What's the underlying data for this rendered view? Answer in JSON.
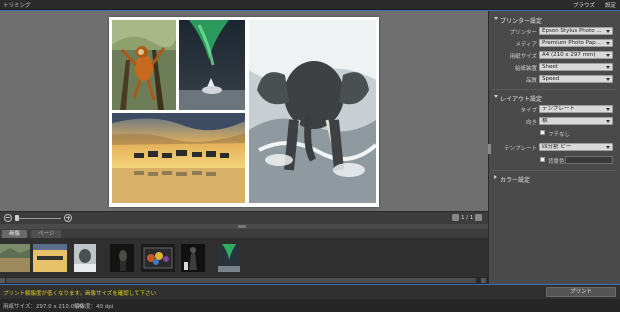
{
  "window": {
    "title": "トリミング"
  },
  "menu": {
    "items": [
      "ブラウズ",
      "設定"
    ]
  },
  "preview": {
    "photos": [
      "monkey-photo",
      "aurora-photo",
      "zebras-photo",
      "elephant-photo"
    ]
  },
  "zoom": {
    "level": 0.05,
    "page_indicator": "1 / 1"
  },
  "tabs": {
    "items": [
      "画像",
      "ページ"
    ],
    "active": "画像"
  },
  "filmstrip": {
    "thumbnails": [
      "landscape",
      "zebras",
      "elephant",
      "dark-portrait",
      "flowers",
      "dark-figure",
      "aurora"
    ]
  },
  "status": {
    "warning": "プリント解像度が低くなります。画像サイズを確認して下さい",
    "print_button": "プリント",
    "paper_size_label": "用紙サイズ：297.0 x 210.0 (A)",
    "resolution_label": "解像度：40 dpi"
  },
  "panel": {
    "printer_settings": {
      "title": "プリンター設定",
      "rows": [
        {
          "label": "プリンター",
          "value": "Epson Stylus Photo ..."
        },
        {
          "label": "メディア",
          "value": "Premium Photo Pap..."
        },
        {
          "label": "用紙サイズ",
          "value": "A4 (210 x 297 mm)"
        },
        {
          "label": "給紙装置",
          "value": "Sheet"
        },
        {
          "label": "品質",
          "value": "Speed"
        }
      ]
    },
    "layout_settings": {
      "title": "レイアウト設定",
      "rows": [
        {
          "label": "タイプ",
          "value": "テンプレート"
        },
        {
          "label": "向き",
          "value": "横"
        }
      ],
      "borderless_label": "フチなし",
      "template_label": "テンプレート",
      "template_value": "四分割 ピー",
      "background_label": "背景色"
    },
    "color_settings": {
      "title": "カラー設定"
    }
  },
  "colors": {
    "accent": "#3f6fb3",
    "warning": "#e0d020",
    "panel": "#4a4a4a"
  }
}
